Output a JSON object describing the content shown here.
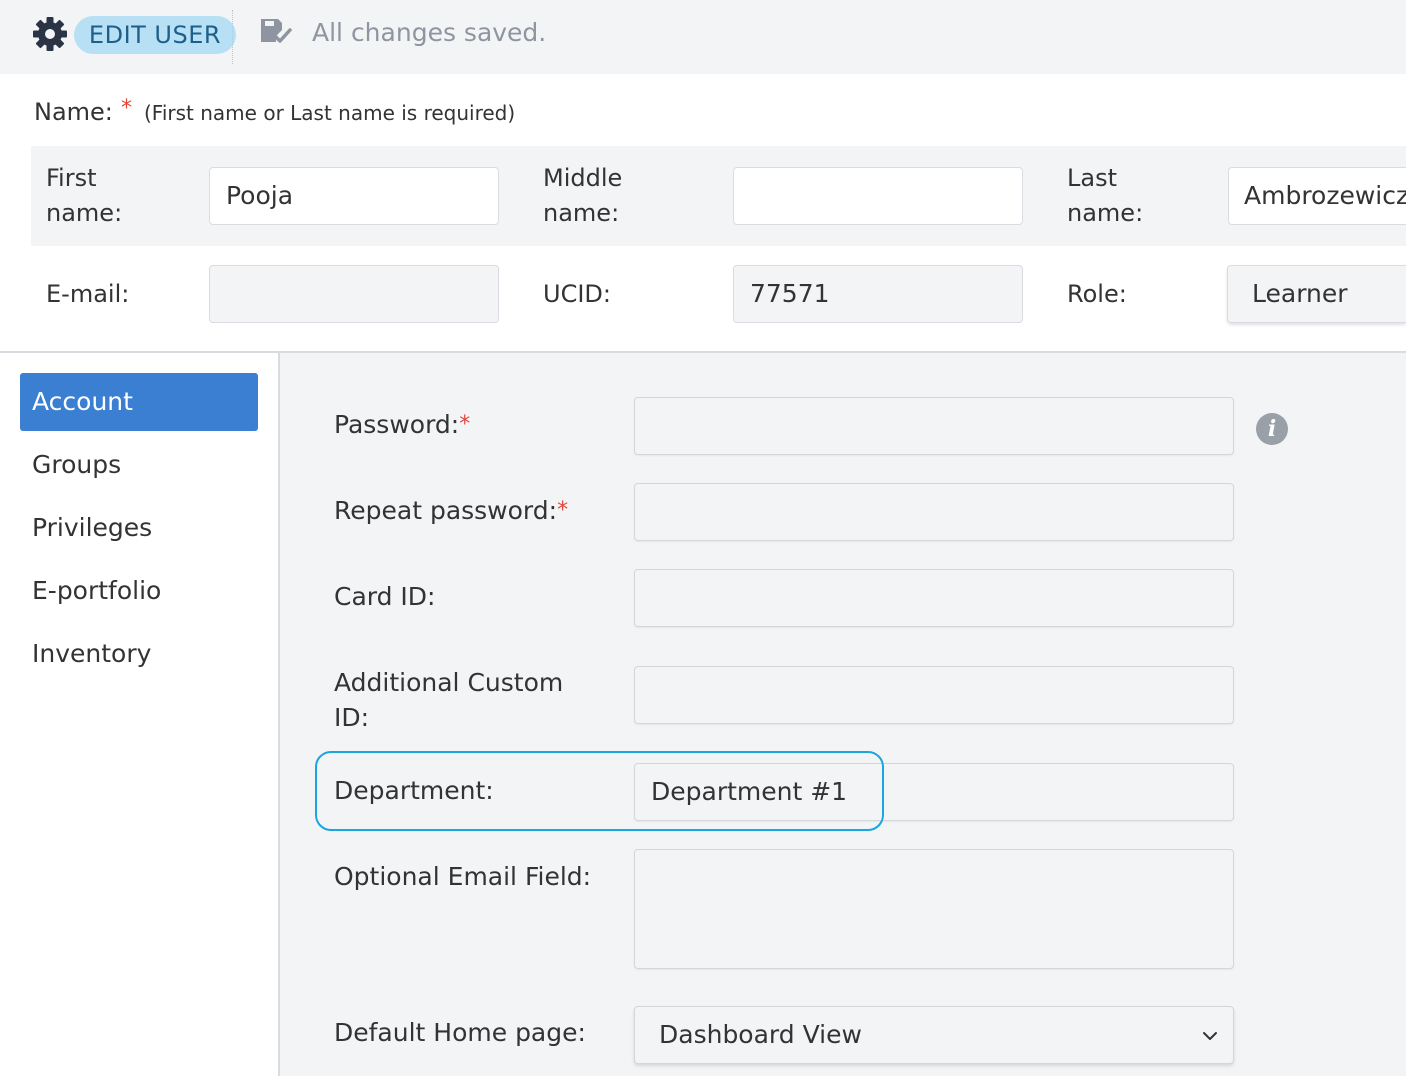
{
  "toolbar": {
    "title": "EDIT USER",
    "status": "All changes saved."
  },
  "name_section": {
    "label": "Name:",
    "required_mark": "*",
    "hint": "(First name or Last name is required)",
    "first_name_label": "First name:",
    "first_name_value": "Pooja",
    "middle_name_label": "Middle name:",
    "middle_name_value": "",
    "last_name_label": "Last name:",
    "last_name_value": "Ambrozewicz",
    "email_label": "E-mail:",
    "email_value": "",
    "ucid_label": "UCID:",
    "ucid_value": "77571",
    "role_label": "Role:",
    "role_value": "Learner"
  },
  "sidebar": {
    "items": [
      {
        "label": "Account",
        "active": true
      },
      {
        "label": "Groups",
        "active": false
      },
      {
        "label": "Privileges",
        "active": false
      },
      {
        "label": "E-portfolio",
        "active": false
      },
      {
        "label": "Inventory",
        "active": false
      }
    ]
  },
  "account_form": {
    "password_label": "Password:",
    "repeat_password_label": "Repeat password:",
    "required_mark": "*",
    "card_id_label": "Card ID:",
    "additional_custom_id_label": "Additional Custom ID:",
    "department_label": "Department:",
    "department_value": "Department #1",
    "optional_email_label": "Optional Email Field:",
    "default_home_label": "Default Home page:",
    "default_home_value": "Dashboard View"
  },
  "icons": {
    "settings": "gear-icon",
    "save": "save-check-icon",
    "info": "info-icon",
    "dropdown": "chevron-down-icon"
  },
  "colors": {
    "accent_active": "#3a7fd2",
    "badge_bg": "#b7e0f4",
    "badge_text": "#1d5f8a",
    "required": "#e0483c",
    "highlight": "#1aa6de"
  }
}
